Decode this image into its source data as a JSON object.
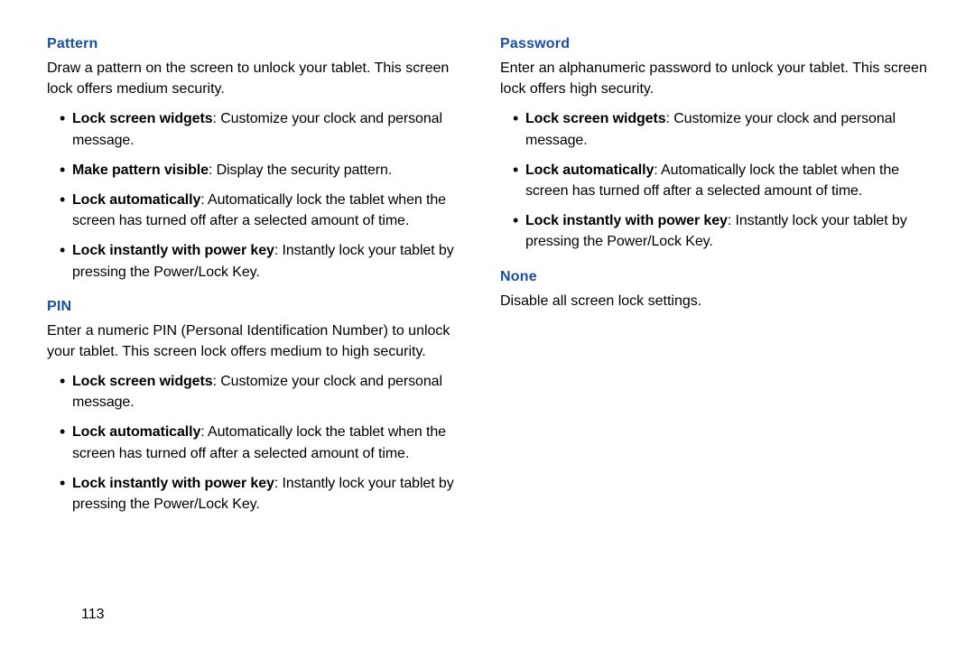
{
  "page_number": "113",
  "left": {
    "pattern": {
      "heading": "Pattern",
      "body": "Draw a pattern on the screen to unlock your tablet. This screen lock offers medium security.",
      "items": [
        {
          "term": "Lock screen widgets",
          "desc": ": Customize your clock and personal message."
        },
        {
          "term": "Make pattern visible",
          "desc": ": Display the security pattern."
        },
        {
          "term": "Lock automatically",
          "desc": ": Automatically lock the tablet when the screen has turned off after a selected amount of time."
        },
        {
          "term": "Lock instantly with power key",
          "desc": ": Instantly lock your tablet by pressing the Power/Lock Key."
        }
      ]
    },
    "pin": {
      "heading": "PIN",
      "body": "Enter a numeric PIN (Personal Identification Number) to unlock your tablet. This screen lock offers medium to high security.",
      "items": [
        {
          "term": "Lock screen widgets",
          "desc": ": Customize your clock and personal message."
        },
        {
          "term": "Lock automatically",
          "desc": ": Automatically lock the tablet when the screen has turned off after a selected amount of time."
        },
        {
          "term": "Lock instantly with power key",
          "desc": ": Instantly lock your tablet by pressing the Power/Lock Key."
        }
      ]
    }
  },
  "right": {
    "password": {
      "heading": "Password",
      "body": "Enter an alphanumeric password to unlock your tablet. This screen lock offers high security.",
      "items": [
        {
          "term": "Lock screen widgets",
          "desc": ": Customize your clock and personal message."
        },
        {
          "term": "Lock automatically",
          "desc": ": Automatically lock the tablet when the screen has turned off after a selected amount of time."
        },
        {
          "term": "Lock instantly with power key",
          "desc": ": Instantly lock your tablet by pressing the Power/Lock Key."
        }
      ]
    },
    "none": {
      "heading": "None",
      "body": "Disable all screen lock settings."
    }
  }
}
